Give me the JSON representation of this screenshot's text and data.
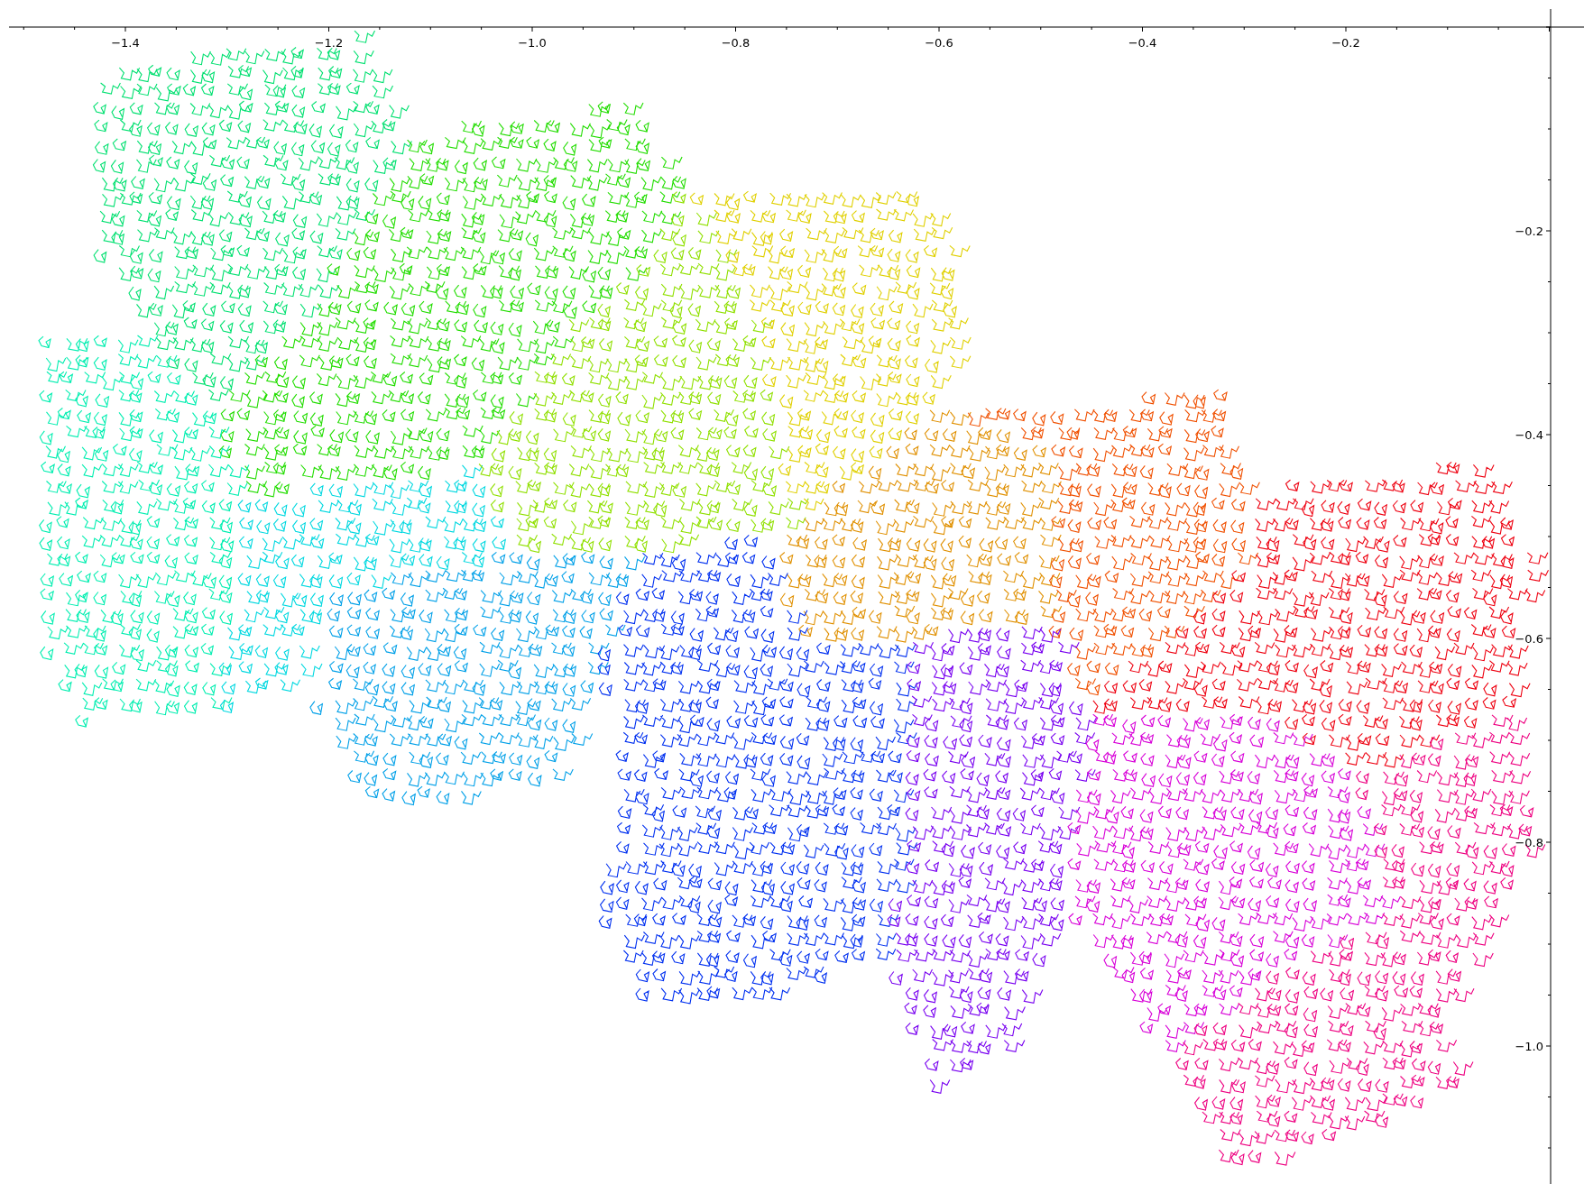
{
  "x_axis": {
    "tick_labels": [
      "−1.4",
      "−1.2",
      "−1.0",
      "−0.8",
      "−0.6",
      "−0.4",
      "−0.2"
    ]
  },
  "y_axis": {
    "tick_labels": [
      "−0.2",
      "−0.4",
      "−0.6",
      "−0.8",
      "−1.0"
    ]
  },
  "regions": [
    {
      "color": "#00e070"
    },
    {
      "color": "#22dd00"
    },
    {
      "color": "#00eeb0"
    },
    {
      "color": "#00d8e0"
    },
    {
      "color": "#00a0e8"
    },
    {
      "color": "#90e000"
    },
    {
      "color": "#e0d000"
    },
    {
      "color": "#e09000"
    },
    {
      "color": "#f05000"
    },
    {
      "color": "#ee0010"
    },
    {
      "color": "#0030f0"
    },
    {
      "color": "#7800f0"
    },
    {
      "color": "#d800d8"
    },
    {
      "color": "#ee0080"
    }
  ]
}
